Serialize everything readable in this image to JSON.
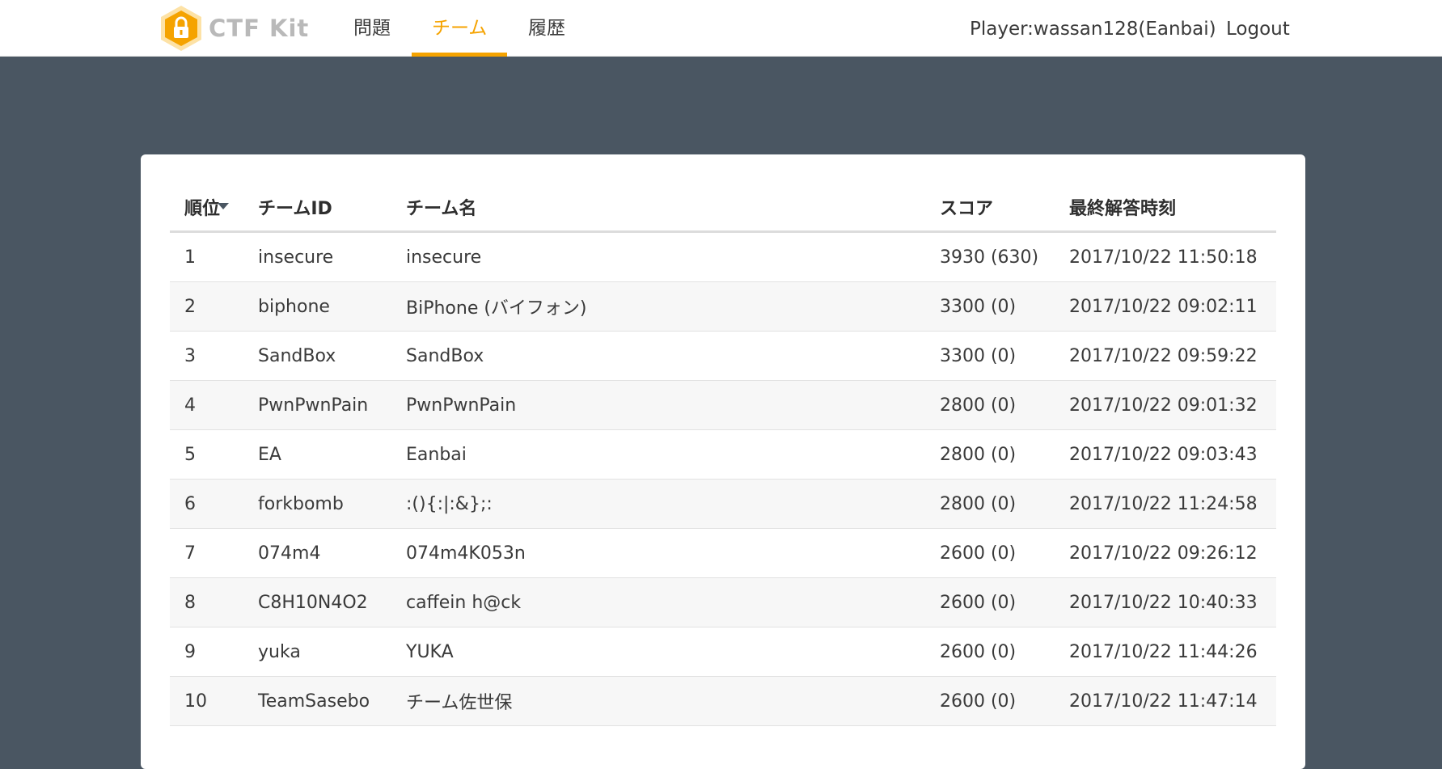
{
  "brand": {
    "name": "CTF Kit",
    "accent": "#f5a300"
  },
  "nav": {
    "items": [
      {
        "label": "問題"
      },
      {
        "label": "チーム"
      },
      {
        "label": "履歴"
      }
    ],
    "active_index": 1,
    "player": "Player:wassan128(Eanbai)",
    "logout": "Logout"
  },
  "table": {
    "headers": {
      "rank": "順位",
      "team_id": "チームID",
      "team_name": "チーム名",
      "score": "スコア",
      "last_time": "最終解答時刻"
    },
    "sort_icon": "sort-caret-down-icon",
    "rows": [
      {
        "rank": "1",
        "team_id": "insecure",
        "team_name": "insecure",
        "score": "3930 (630)",
        "last_time": "2017/10/22 11:50:18"
      },
      {
        "rank": "2",
        "team_id": "biphone",
        "team_name": "BiPhone (バイフォン)",
        "score": "3300 (0)",
        "last_time": "2017/10/22 09:02:11"
      },
      {
        "rank": "3",
        "team_id": "SandBox",
        "team_name": "SandBox",
        "score": "3300 (0)",
        "last_time": "2017/10/22 09:59:22"
      },
      {
        "rank": "4",
        "team_id": "PwnPwnPain",
        "team_name": "PwnPwnPain",
        "score": "2800 (0)",
        "last_time": "2017/10/22 09:01:32"
      },
      {
        "rank": "5",
        "team_id": "EA",
        "team_name": "Eanbai",
        "score": "2800 (0)",
        "last_time": "2017/10/22 09:03:43"
      },
      {
        "rank": "6",
        "team_id": "forkbomb",
        "team_name": ":(){:|:&};:",
        "score": "2800 (0)",
        "last_time": "2017/10/22 11:24:58"
      },
      {
        "rank": "7",
        "team_id": "074m4",
        "team_name": "074m4K053n",
        "score": "2600 (0)",
        "last_time": "2017/10/22 09:26:12"
      },
      {
        "rank": "8",
        "team_id": "C8H10N4O2",
        "team_name": "caffein h@ck",
        "score": "2600 (0)",
        "last_time": "2017/10/22 10:40:33"
      },
      {
        "rank": "9",
        "team_id": "yuka",
        "team_name": "YUKA",
        "score": "2600 (0)",
        "last_time": "2017/10/22 11:44:26"
      },
      {
        "rank": "10",
        "team_id": "TeamSasebo",
        "team_name": "チーム佐世保",
        "score": "2600 (0)",
        "last_time": "2017/10/22 11:47:14"
      }
    ]
  }
}
